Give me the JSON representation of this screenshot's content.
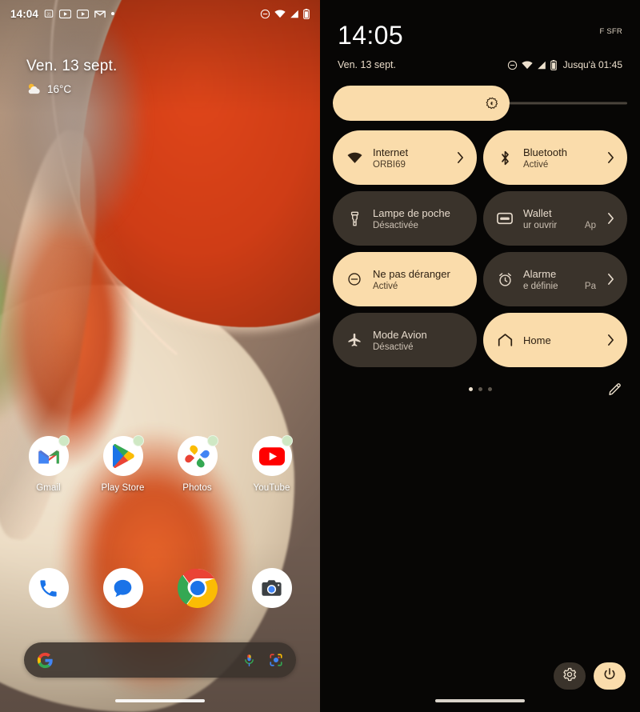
{
  "home": {
    "status_bar": {
      "clock": "14:04",
      "notification_icons": [
        "calendar-icon",
        "youtube-icon",
        "youtube-icon",
        "gmail-icon",
        "more-dot-icon"
      ],
      "system_icons": [
        "do-not-disturb-icon",
        "wifi-icon",
        "cellular-signal-icon",
        "battery-icon"
      ]
    },
    "widget": {
      "date": "Ven. 13 sept.",
      "weather_icon": "partly-cloudy-icon",
      "temperature": "16°C"
    },
    "apps": [
      {
        "label": "Gmail",
        "icon": "gmail-icon",
        "badge": true
      },
      {
        "label": "Play Store",
        "icon": "play-store-icon",
        "badge": true
      },
      {
        "label": "Photos",
        "icon": "google-photos-icon",
        "badge": true
      },
      {
        "label": "YouTube",
        "icon": "youtube-icon",
        "badge": true
      }
    ],
    "dock": [
      {
        "label": "Phone",
        "icon": "phone-icon"
      },
      {
        "label": "Messages",
        "icon": "messages-icon"
      },
      {
        "label": "Chrome",
        "icon": "chrome-icon"
      },
      {
        "label": "Camera",
        "icon": "camera-icon"
      }
    ],
    "search": {
      "logo": "google-g-icon",
      "placeholder": "",
      "value": "",
      "mic_icon": "microphone-icon",
      "lens_icon": "google-lens-icon"
    }
  },
  "quick_settings": {
    "clock": "14:05",
    "carrier": "F SFR",
    "date": "Ven. 13 sept.",
    "status_icons": [
      "do-not-disturb-icon",
      "wifi-icon",
      "cellular-signal-icon",
      "battery-icon"
    ],
    "battery_until": "Jusqu'à 01:45",
    "brightness": {
      "label": "Brightness",
      "icon": "brightness-icon",
      "percent": 60
    },
    "tiles": [
      {
        "title": "Internet",
        "subtitle": "ORBI69",
        "icon": "wifi-icon",
        "state": "on",
        "chevron": true
      },
      {
        "title": "Bluetooth",
        "subtitle": "Activé",
        "icon": "bluetooth-icon",
        "state": "on",
        "chevron": true
      },
      {
        "title": "Lampe de poche",
        "subtitle": "Désactivée",
        "icon": "flashlight-icon",
        "state": "off",
        "chevron": false
      },
      {
        "title": "Wallet",
        "subtitle": "ur ouvrir",
        "subtitle2": "Ap",
        "icon": "wallet-icon",
        "state": "off",
        "chevron": true
      },
      {
        "title": "Ne pas déranger",
        "subtitle": "Activé",
        "icon": "do-not-disturb-icon",
        "state": "on",
        "chevron": false
      },
      {
        "title": "Alarme",
        "subtitle": "e définie",
        "subtitle2": "Pa",
        "icon": "alarm-icon",
        "state": "off",
        "chevron": true
      },
      {
        "title": "Mode Avion",
        "subtitle": "Désactivé",
        "icon": "airplane-icon",
        "state": "off",
        "chevron": false
      },
      {
        "title": "Home",
        "subtitle": "",
        "icon": "home-icon",
        "state": "on",
        "chevron": true
      }
    ],
    "pages": {
      "count": 3,
      "active": 1
    },
    "edit_icon": "pencil-icon",
    "settings_icon": "gear-icon",
    "power_icon": "power-icon"
  },
  "colors": {
    "tile_on": "#fadcab",
    "tile_off": "#3a332b",
    "qs_background": "#070605",
    "accent_text_dark": "#2e2113",
    "badge_green": "#cfe8c4"
  }
}
